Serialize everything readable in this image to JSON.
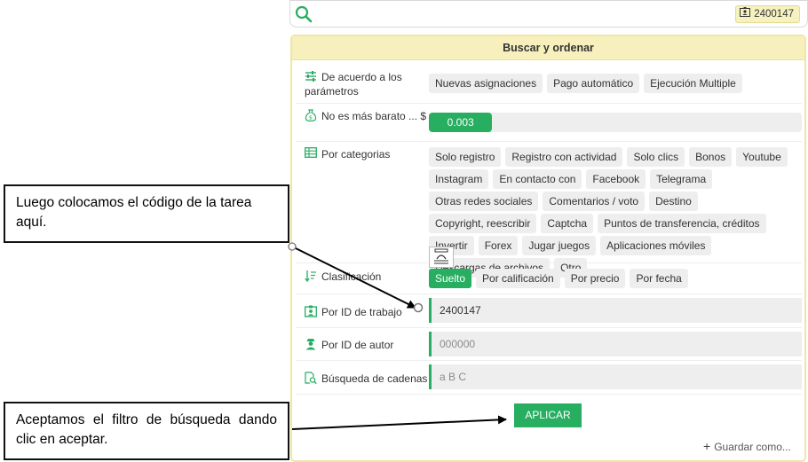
{
  "topbar": {
    "search_icon": "search-icon",
    "badge_icon": "id-card-icon",
    "badge_value": "2400147"
  },
  "panel": {
    "title": "Buscar y ordenar"
  },
  "params": {
    "label": "De acuerdo a los parámetros",
    "icon": "sliders-icon",
    "chips": [
      "Nuevas asignaciones",
      "Pago automático",
      "Ejecución Multiple"
    ]
  },
  "price": {
    "label": "No es más barato ... $",
    "icon": "money-bag-icon",
    "value": "0.003",
    "fraction": 0.17
  },
  "categories": {
    "label": "Por categorias",
    "icon": "table-icon",
    "chips": [
      "Solo registro",
      "Registro con actividad",
      "Solo clics",
      "Bonos",
      "Youtube",
      "Instagram",
      "En contacto con",
      "Facebook",
      "Telegrama",
      "Otras redes sociales",
      "Comentarios / voto",
      "Destino",
      "Copyright, reescribir",
      "Captcha",
      "Puntos de transferencia, créditos",
      "Invertir",
      "Forex",
      "Jugar juegos",
      "Aplicaciones móviles",
      "Descargas de archivos",
      "Otro"
    ]
  },
  "sort": {
    "label": "Clasificación",
    "icon": "sort-icon",
    "chips": [
      "Suelto",
      "Por calificación",
      "Por precio",
      "Por fecha"
    ],
    "active_index": 0
  },
  "job_id": {
    "label": "Por ID de trabajo",
    "icon": "id-card-icon",
    "value": "2400147",
    "placeholder": ""
  },
  "author_id": {
    "label": "Por ID de autor",
    "icon": "user-icon",
    "value": "",
    "placeholder": "000000"
  },
  "string_search": {
    "label": "Búsqueda de cadenas",
    "icon": "doc-search-icon",
    "value": "",
    "placeholder": "a B C"
  },
  "actions": {
    "apply_label": "APLICAR",
    "save_label": "Guardar como..."
  },
  "callouts": {
    "first": "Luego colocamos el código de la tarea aquí.",
    "second": "Aceptamos el filtro de búsqueda dando clic en aceptar."
  },
  "colors": {
    "accent": "#27ae60",
    "header_bg": "#f7f0bd",
    "chip_bg": "#eeeeee"
  }
}
